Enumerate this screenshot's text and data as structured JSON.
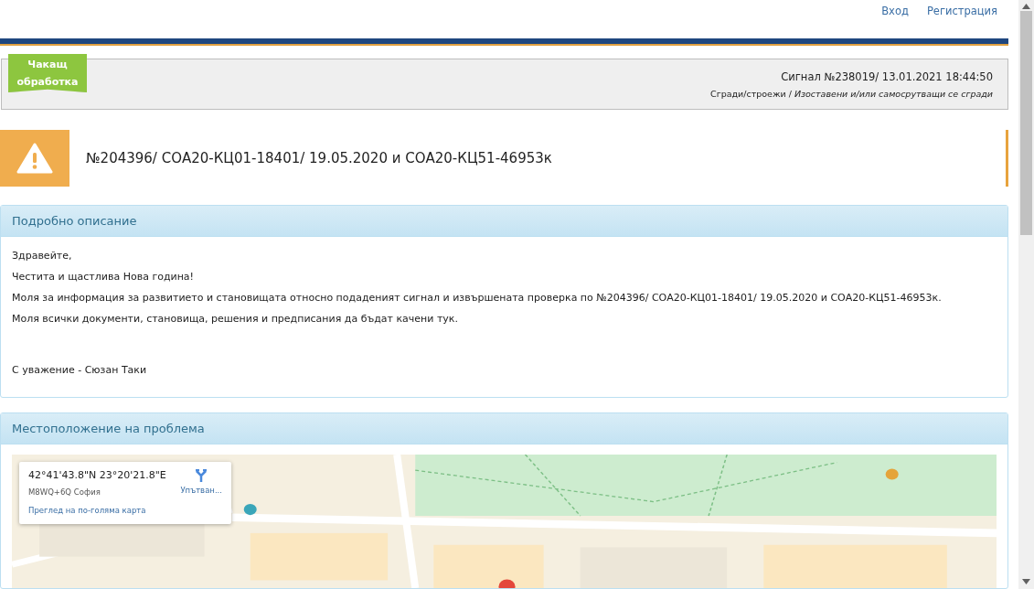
{
  "header": {
    "links": [
      {
        "label": "Вход"
      },
      {
        "label": "Регистрация"
      }
    ]
  },
  "signal": {
    "status": "Чакащ обработка",
    "number": "Сигнал №238019/ 13.01.2021 18:44:50",
    "category": "Сгради/строежи / *Изоставени и/или самосрутващи се сгради*"
  },
  "alert": {
    "kind": "warning",
    "title": "№204396/ СОА20-КЦ01-18401/ 19.05.2020 и СОА20-КЦ51-46953к"
  },
  "description": {
    "title": "Подробно описание",
    "paragraphs": [
      "Здравейте,",
      "Честита и щастлива Нова година!",
      "Моля за информация за развитието и становищата относно подаденият сигнал и извършената проверка по №204396/ СОА20-КЦ01-18401/ 19.05.2020 и СОА20-КЦ51-46953к.",
      "Моля всички документи, становища, решения и предписания да бъдат качени тук."
    ],
    "signature": "С уважение - Сюзан Таки"
  },
  "location": {
    "title": "Местоположение на проблема",
    "map": {
      "card": {
        "coordinates": "42°41'43.8\"N 23°20'21.8\"E",
        "plus_code": "M8WQ+6Q София",
        "directions": "Упътван...",
        "larger_map": "Преглед на по-голяма карта"
      }
    }
  }
}
